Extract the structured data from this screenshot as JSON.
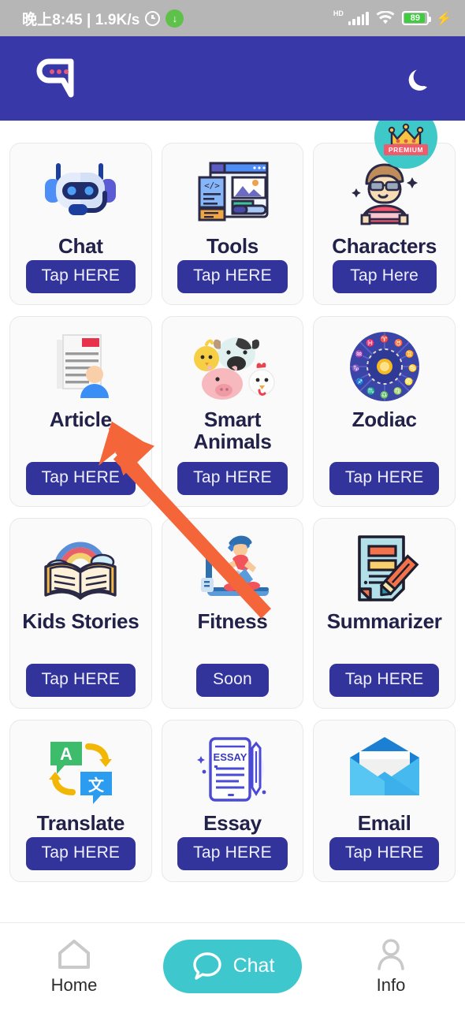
{
  "status_bar": {
    "time_text": "晚上8:45 | 1.9K/s",
    "alarm_icon": "alarm-icon",
    "download_icon": "download-icon",
    "hd_label": "HD",
    "signal_icon": "signal-bars-icon",
    "wifi_icon": "wifi-icon",
    "battery_percent": "89",
    "charging_icon": "charging-bolt-icon"
  },
  "app_bar": {
    "logo_icon": "chat-bubble-logo-icon",
    "dark_mode_icon": "moon-icon"
  },
  "premium": {
    "label": "PREMIUM",
    "crown_icon": "crown-icon",
    "badge_color": "#3ec8c8",
    "label_color": "#f05a6a"
  },
  "theme": {
    "header_color": "#3838a8",
    "button_color": "#33339c",
    "accent_teal": "#3ec8ce",
    "title_color": "#21214a",
    "card_bg": "#fafafa",
    "arrow_color": "#f4663a"
  },
  "annotation": {
    "arrow_icon": "pointer-arrow-annotation",
    "points_to": "chat-tap-here-button"
  },
  "grid": {
    "cards": [
      {
        "id": "chat",
        "title": "Chat",
        "cta": "Tap HERE",
        "icon": "robot-headset-icon",
        "premium": false,
        "tall": false,
        "enabled": true
      },
      {
        "id": "tools",
        "title": "Tools",
        "cta": "Tap HERE",
        "icon": "web-code-editor-icon",
        "premium": false,
        "tall": false,
        "enabled": true
      },
      {
        "id": "characters",
        "title": "Characters",
        "cta": "Tap Here",
        "icon": "person-avatar-icon",
        "premium": true,
        "tall": false,
        "enabled": true
      },
      {
        "id": "article",
        "title": "Article",
        "cta": "Tap HERE",
        "icon": "document-person-icon",
        "premium": false,
        "tall": true,
        "enabled": true
      },
      {
        "id": "smartanimals",
        "title": "Smart Animals",
        "cta": "Tap HERE",
        "icon": "farm-animals-icon",
        "premium": false,
        "tall": true,
        "enabled": true
      },
      {
        "id": "zodiac",
        "title": "Zodiac",
        "cta": "Tap HERE",
        "icon": "zodiac-wheel-icon",
        "premium": false,
        "tall": true,
        "enabled": true
      },
      {
        "id": "kidsstories",
        "title": "Kids Stories",
        "cta": "Tap HERE",
        "icon": "open-book-rainbow-icon",
        "premium": false,
        "tall": true,
        "enabled": true
      },
      {
        "id": "fitness",
        "title": "Fitness",
        "cta": "Soon",
        "icon": "treadmill-runner-icon",
        "premium": false,
        "tall": true,
        "enabled": false
      },
      {
        "id": "summarizer",
        "title": "Summarizer",
        "cta": "Tap HERE",
        "icon": "document-pencil-icon",
        "premium": false,
        "tall": true,
        "enabled": true
      },
      {
        "id": "translate",
        "title": "Translate",
        "cta": "Tap HERE",
        "icon": "translate-bubbles-icon",
        "premium": false,
        "tall": false,
        "enabled": true
      },
      {
        "id": "essay",
        "title": "Essay",
        "cta": "Tap HERE",
        "icon": "essay-pen-icon",
        "premium": false,
        "tall": false,
        "enabled": true
      },
      {
        "id": "email",
        "title": "Email",
        "cta": "Tap HERE",
        "icon": "envelope-icon",
        "premium": false,
        "tall": false,
        "enabled": true
      }
    ]
  },
  "bottom_nav": {
    "items": [
      {
        "id": "home",
        "label": "Home",
        "icon": "home-icon",
        "active": false
      },
      {
        "id": "chat",
        "label": "Chat",
        "icon": "chat-bubble-icon",
        "active": true
      },
      {
        "id": "info",
        "label": "Info",
        "icon": "person-icon",
        "active": false
      }
    ]
  }
}
